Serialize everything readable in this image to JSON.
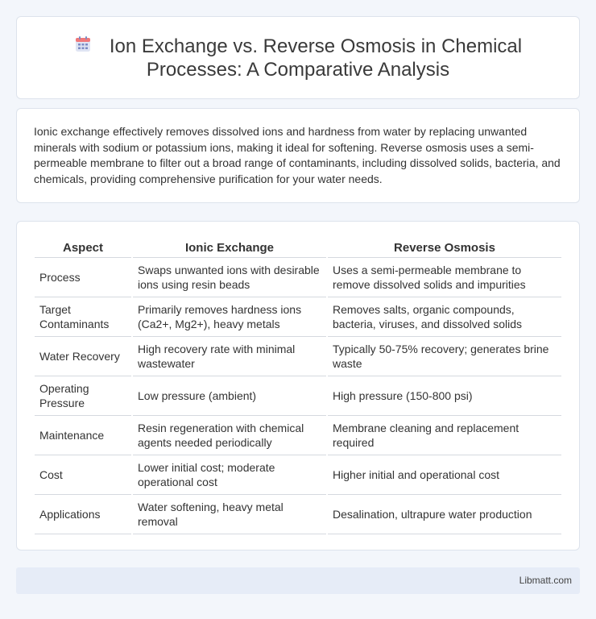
{
  "header": {
    "icon": "calendar-icon",
    "title": "Ion Exchange vs. Reverse Osmosis in Chemical Processes: A Comparative Analysis"
  },
  "intro": {
    "text": "Ionic exchange effectively removes dissolved ions and hardness from water by replacing unwanted minerals with sodium or potassium ions, making it ideal for softening. Reverse osmosis uses a semi-permeable membrane to filter out a broad range of contaminants, including dissolved solids, bacteria, and chemicals, providing comprehensive purification for your water needs."
  },
  "table": {
    "headers": [
      "Aspect",
      "Ionic Exchange",
      "Reverse Osmosis"
    ],
    "rows": [
      [
        "Process",
        "Swaps unwanted ions with desirable ions using resin beads",
        "Uses a semi-permeable membrane to remove dissolved solids and impurities"
      ],
      [
        "Target Contaminants",
        "Primarily removes hardness ions (Ca2+, Mg2+), heavy metals",
        "Removes salts, organic compounds, bacteria, viruses, and dissolved solids"
      ],
      [
        "Water Recovery",
        "High recovery rate with minimal wastewater",
        "Typically 50-75% recovery; generates brine waste"
      ],
      [
        "Operating Pressure",
        "Low pressure (ambient)",
        "High pressure (150-800 psi)"
      ],
      [
        "Maintenance",
        "Resin regeneration with chemical agents needed periodically",
        "Membrane cleaning and replacement required"
      ],
      [
        "Cost",
        "Lower initial cost; moderate operational cost",
        "Higher initial and operational cost"
      ],
      [
        "Applications",
        "Water softening, heavy metal removal",
        "Desalination, ultrapure water production"
      ]
    ]
  },
  "footer": {
    "brand": "Libmatt.com"
  }
}
